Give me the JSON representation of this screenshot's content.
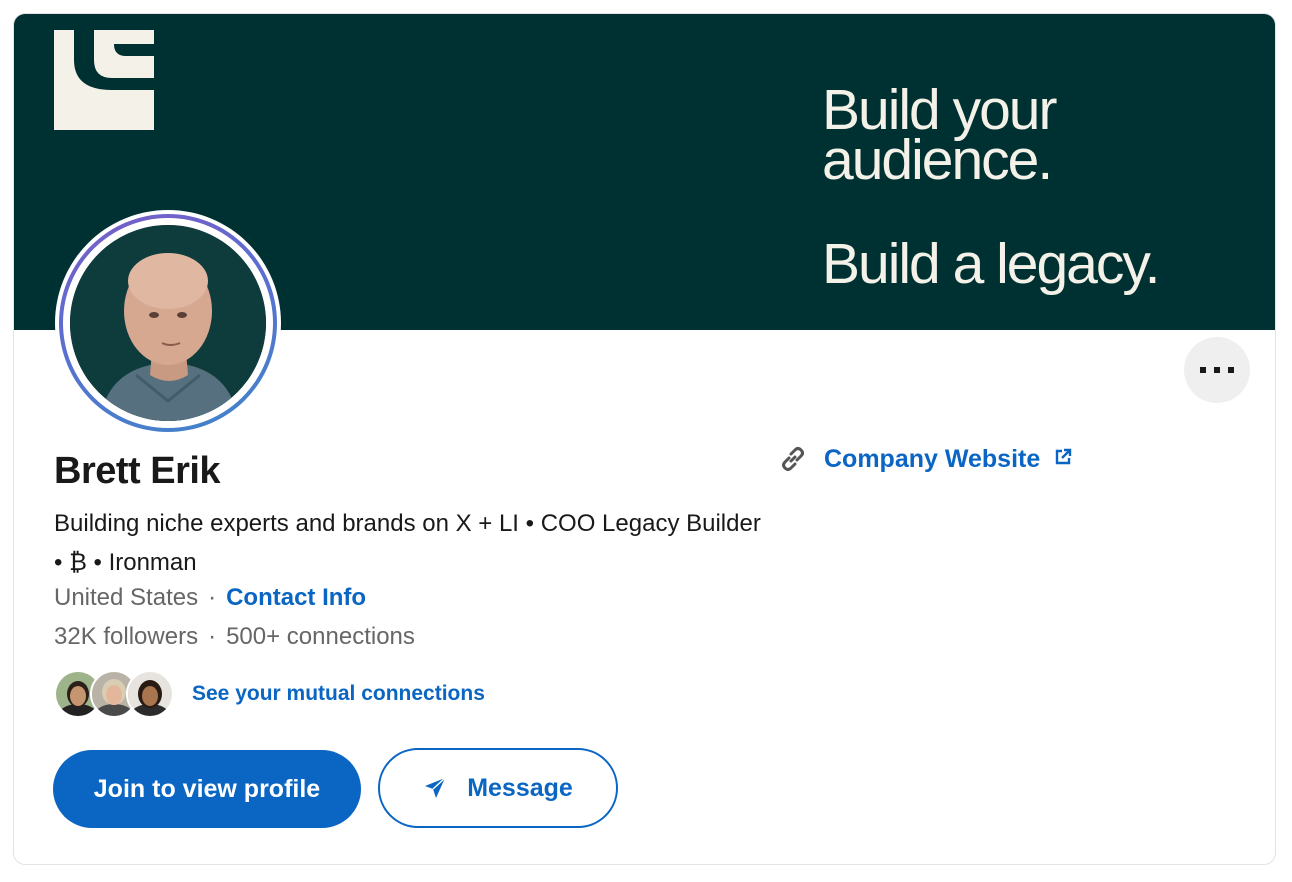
{
  "banner": {
    "line1": "Build your",
    "line2": "audience.",
    "line3": "Build a legacy.",
    "colors": {
      "background": "#003132",
      "text": "#f3f1e8"
    },
    "logo_icon": "legacy-builder-logo"
  },
  "profile": {
    "name": "Brett Erik",
    "headline": "Building niche experts and brands on X + LI • COO Legacy Builder • ₿ • Ironman",
    "location": "United States",
    "contact_info_label": "Contact Info",
    "followers": "32K followers",
    "connections": "500+ connections",
    "separator": "·"
  },
  "company_website": {
    "label": "Company Website",
    "link_icon": "link-icon",
    "external_icon": "external-link-icon"
  },
  "mutual": {
    "label": "See your mutual connections",
    "avatars": [
      "mutual-avatar-1",
      "mutual-avatar-2",
      "mutual-avatar-3"
    ]
  },
  "actions": {
    "join_label": "Join to view profile",
    "message_label": "Message",
    "message_icon": "send-icon",
    "more_icon": "more-dots-icon"
  },
  "colors": {
    "accent": "#0a66c2",
    "muted_text": "#666666"
  }
}
